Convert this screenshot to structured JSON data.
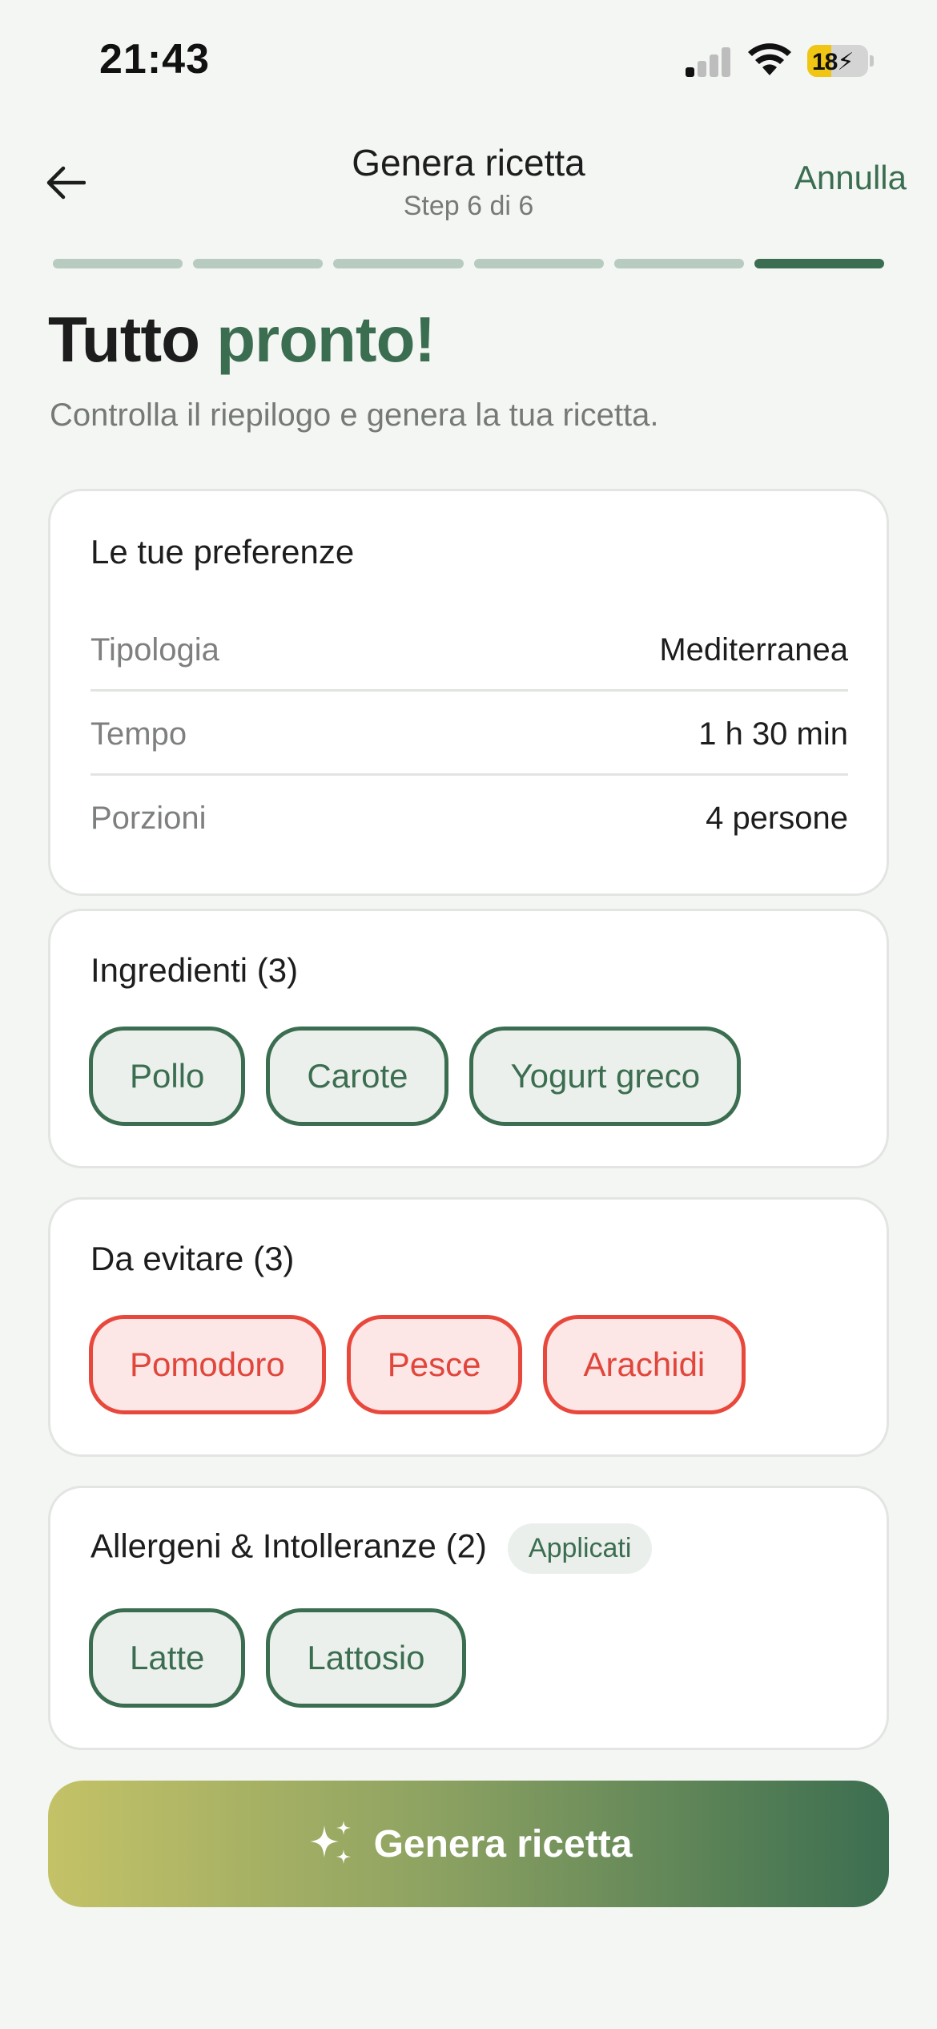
{
  "status_bar": {
    "time": "21:43",
    "battery_percent": "18",
    "battery_level": 0.18,
    "icons": [
      "signal-icon",
      "wifi-icon",
      "battery-icon",
      "charging-bolt-icon"
    ]
  },
  "header": {
    "title": "Genera ricetta",
    "step": "Step 6 di 6",
    "cancel_label": "Annulla",
    "back_icon": "arrow-left-icon"
  },
  "progress": {
    "total_steps": 6,
    "current_step": 6
  },
  "intro": {
    "headline_part1": "Tutto",
    "headline_accent": "pronto!",
    "subtitle": "Controlla il riepilogo e genera la tua ricetta."
  },
  "preferences": {
    "title": "Le tue preferenze",
    "rows": [
      {
        "label": "Tipologia",
        "value": "Mediterranea"
      },
      {
        "label": "Tempo",
        "value": "1 h 30 min"
      },
      {
        "label": "Porzioni",
        "value": "4 persone"
      }
    ]
  },
  "ingredients": {
    "title": "Ingredienti (3)",
    "items": [
      "Pollo",
      "Carote",
      "Yogurt greco"
    ]
  },
  "avoid": {
    "title": "Da evitare (3)",
    "items": [
      "Pomodoro",
      "Pesce",
      "Arachidi"
    ]
  },
  "allergens": {
    "title": "Allergeni & Intolleranze (2)",
    "badge": "Applicati",
    "items": [
      "Latte",
      "Lattosio"
    ]
  },
  "cta": {
    "label": "Genera ricetta",
    "icon": "sparkles-icon"
  },
  "colors": {
    "accent": "#3b6e50",
    "danger": "#e8483c",
    "background": "#f4f6f3",
    "gradient_start": "#c4c267",
    "gradient_end": "#3b6e50"
  }
}
